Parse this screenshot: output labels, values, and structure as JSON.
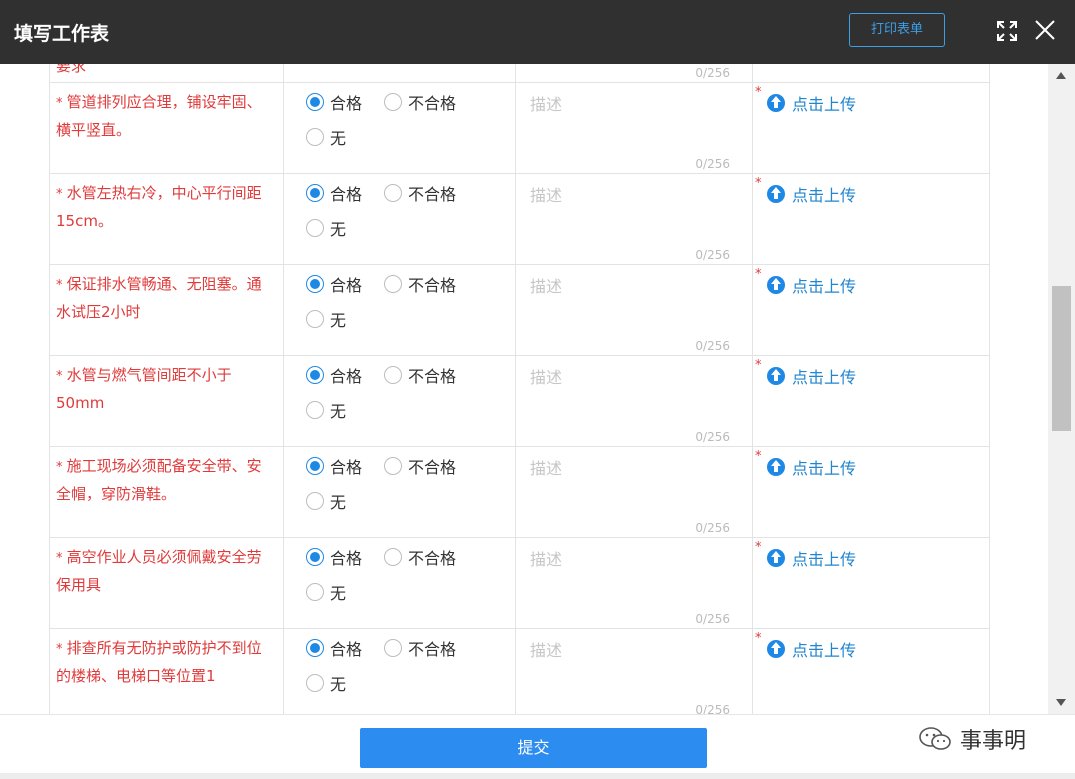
{
  "window": {
    "title": "填写工作表",
    "print_label": "打印表单"
  },
  "top_row": {
    "requirement_fragment": "要求",
    "counter": "0/256"
  },
  "rows": [
    {
      "requirement": "管道排列应合理，铺设牢固、横平竖直。",
      "options": [
        "合格",
        "不合格",
        "无"
      ],
      "selected": "合格",
      "desc_placeholder": "描述",
      "counter": "0/256",
      "upload_label": "点击上传"
    },
    {
      "requirement": "水管左热右冷，中心平行间距15cm。",
      "options": [
        "合格",
        "不合格",
        "无"
      ],
      "selected": "合格",
      "desc_placeholder": "描述",
      "counter": "0/256",
      "upload_label": "点击上传"
    },
    {
      "requirement": "保证排水管畅通、无阻塞。通水试压2小时",
      "options": [
        "合格",
        "不合格",
        "无"
      ],
      "selected": "合格",
      "desc_placeholder": "描述",
      "counter": "0/256",
      "upload_label": "点击上传"
    },
    {
      "requirement": "水管与燃气管间距不小于50mm",
      "options": [
        "合格",
        "不合格",
        "无"
      ],
      "selected": "合格",
      "desc_placeholder": "描述",
      "counter": "0/256",
      "upload_label": "点击上传"
    },
    {
      "requirement": "施工现场必须配备安全带、安全帽，穿防滑鞋。",
      "options": [
        "合格",
        "不合格",
        "无"
      ],
      "selected": "合格",
      "desc_placeholder": "描述",
      "counter": "0/256",
      "upload_label": "点击上传"
    },
    {
      "requirement": "高空作业人员必须佩戴安全劳保用具",
      "options": [
        "合格",
        "不合格",
        "无"
      ],
      "selected": "合格",
      "desc_placeholder": "描述",
      "counter": "0/256",
      "upload_label": "点击上传"
    },
    {
      "requirement": "排查所有无防护或防护不到位的楼梯、电梯口等位置1",
      "options": [
        "合格",
        "不合格",
        "无"
      ],
      "selected": "合格",
      "desc_placeholder": "描述",
      "counter": "0/256",
      "upload_label": "点击上传"
    }
  ],
  "footer": {
    "submit_label": "提交",
    "brand_text": "事事明"
  },
  "colors": {
    "titlebar": "#303030",
    "accent": "#2d8cf0",
    "required": "#e03a3a"
  },
  "icons": [
    "fullscreen-icon",
    "close-icon",
    "upload-icon",
    "wechat-icon"
  ]
}
